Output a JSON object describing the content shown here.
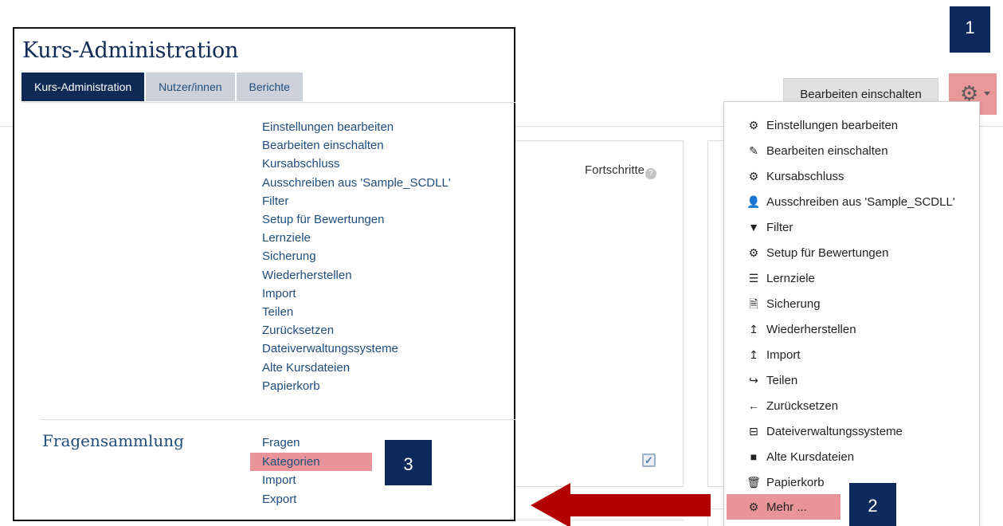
{
  "admin": {
    "title": "Kurs-Administration",
    "tabs": [
      "Kurs-Administration",
      "Nutzer/innen",
      "Berichte"
    ],
    "links": [
      "Einstellungen bearbeiten",
      "Bearbeiten einschalten",
      "Kursabschluss",
      "Ausschreiben aus 'Sample_SCDLL'",
      "Filter",
      "Setup für Bewertungen",
      "Lernziele",
      "Sicherung",
      "Wiederherstellen",
      "Import",
      "Teilen",
      "Zurücksetzen",
      "Dateiverwaltungssysteme",
      "Alte Kursdateien",
      "Papierkorb"
    ],
    "question_bank": {
      "heading": "Fragensammlung",
      "links": [
        "Fragen",
        "Kategorien",
        "Import",
        "Export"
      ]
    }
  },
  "page": {
    "progress_label": "Fortschritte",
    "help_glyph": "?",
    "check_glyph": "✓"
  },
  "header": {
    "edit_button": "Bearbeiten einschalten",
    "gear_icon": "gear-icon"
  },
  "dropdown": {
    "items": [
      {
        "label": "Einstellungen bearbeiten",
        "icon": "gear-icon",
        "glyph": "⚙"
      },
      {
        "label": "Bearbeiten einschalten",
        "icon": "pencil-icon",
        "glyph": "✎"
      },
      {
        "label": "Kursabschluss",
        "icon": "gear-icon",
        "glyph": "⚙"
      },
      {
        "label": "Ausschreiben aus 'Sample_SCDLL'",
        "icon": "user-icon",
        "glyph": "👤"
      },
      {
        "label": "Filter",
        "icon": "filter-icon",
        "glyph": "▼"
      },
      {
        "label": "Setup für Bewertungen",
        "icon": "gear-icon",
        "glyph": "⚙"
      },
      {
        "label": "Lernziele",
        "icon": "list-icon",
        "glyph": "☰"
      },
      {
        "label": "Sicherung",
        "icon": "archive-file-icon",
        "glyph": "🗎"
      },
      {
        "label": "Wiederherstellen",
        "icon": "upload-icon",
        "glyph": "↥"
      },
      {
        "label": "Import",
        "icon": "upload-icon",
        "glyph": "↥"
      },
      {
        "label": "Teilen",
        "icon": "share-icon",
        "glyph": "↪"
      },
      {
        "label": "Zurücksetzen",
        "icon": "arrow-left-icon",
        "glyph": "←"
      },
      {
        "label": "Dateiverwaltungssysteme",
        "icon": "hard-drive-icon",
        "glyph": "⊟"
      },
      {
        "label": "Alte Kursdateien",
        "icon": "folder-icon",
        "glyph": "■"
      },
      {
        "label": "Papierkorb",
        "icon": "trash-icon",
        "glyph": "🗑"
      }
    ],
    "more": {
      "label": "Mehr ...",
      "icon": "gear-icon",
      "glyph": "⚙"
    }
  },
  "callouts": {
    "one": "1",
    "two": "2",
    "three": "3"
  },
  "colors": {
    "navy": "#0f2b55",
    "link": "#1f4d7c",
    "highlight": "#e89498",
    "arrow": "#b30000",
    "callout": "#0e2a5c"
  }
}
